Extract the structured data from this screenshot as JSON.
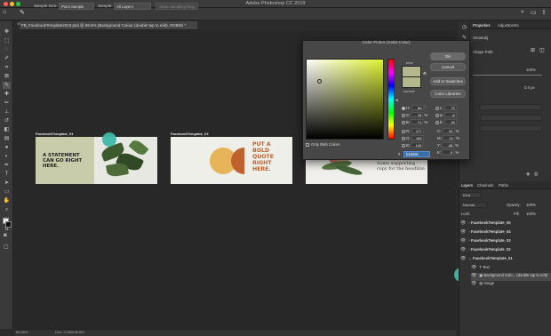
{
  "window": {
    "title": "Adobe Photoshop CC 2019"
  },
  "colors": {
    "accent_marker": "#3fb8a7",
    "selected_color": "#b4b68c",
    "hex_highlight": "#3a6ea8"
  },
  "options_bar": {
    "sample_size_label": "Sample Size:",
    "sample_size_value": "Point Sample",
    "sample_label": "Sample:",
    "sample_value": "All Layers",
    "show_ring_button": "Show Sampling Ring"
  },
  "document": {
    "tab_label": "FB_FacebookTemplate2019.psd @ 66.6% (Background Colour (double tap to edit), RGB/8) *",
    "zoom": "66.66%",
    "doc_size": "Doc: 3.18M/46.6M"
  },
  "artboards": [
    {
      "label": "FacebookTemplate_01",
      "text": "A STATEMENT CAN GO RIGHT HERE."
    },
    {
      "label": "FacebookTemplate_02",
      "text": "PUT A BOLD QUOTE RIGHT HERE."
    },
    {
      "label": "FacebookTemplate_03",
      "text": "Some supporting copy for the headline"
    }
  ],
  "color_picker": {
    "title": "Color Picker (Solid Color)",
    "ok": "OK",
    "cancel": "Cancel",
    "add_swatches": "Add to Swatches",
    "color_libraries": "Color Libraries",
    "new_label": "new",
    "current_label": "current",
    "only_web": "Only Web Colors",
    "fields": {
      "H": "66",
      "H_unit": "°",
      "S": "15",
      "S_unit": "%",
      "B": "71",
      "B_unit": "%",
      "R": "177",
      "G": "182",
      "Bl": "140",
      "L": "73",
      "a": "-6",
      "b": "18",
      "C": "32",
      "M": "21",
      "Y": "48",
      "K": "0",
      "pct": "%"
    },
    "hex_prefix": "#",
    "hex": "b1b68c"
  },
  "right_panels": {
    "tabs_top": [
      "Properties",
      "Adjustments"
    ],
    "properties_item": "Smartobj",
    "shape_label": "Shape Path",
    "percent": "100%",
    "px_value": "0.0 px",
    "tabs_layers": [
      "Layers",
      "Channels",
      "Paths"
    ],
    "kind_label": "Kind",
    "normal": "Normal",
    "opacity_label": "Opacity:",
    "opacity_value": "100%",
    "lock_label": "Lock:",
    "fill_label": "Fill:",
    "fill_value": "100%",
    "layers": [
      "FacebookTemplate_05",
      "FacebookTemplate_04",
      "FacebookTemplate_03",
      "FacebookTemplate_02",
      "FacebookTemplate_01",
      "Text",
      "Background Colo... (double tap to edit)",
      "Image"
    ]
  }
}
